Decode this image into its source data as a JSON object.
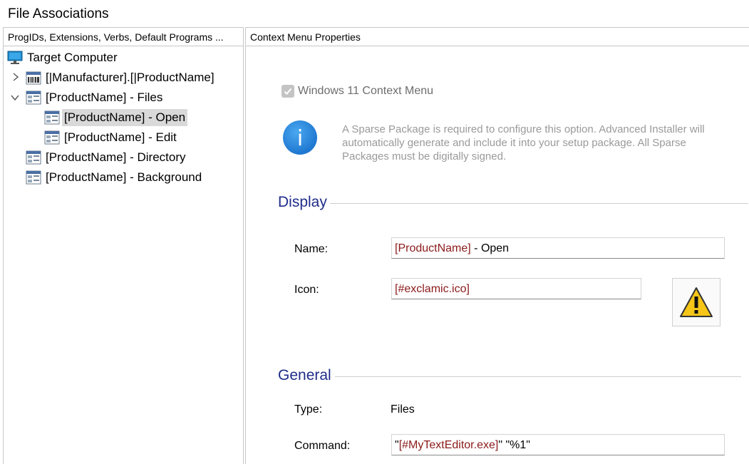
{
  "window": {
    "title": "File Associations"
  },
  "left_pane": {
    "header": "ProgIDs, Extensions, Verbs, Default Programs ...",
    "tree": [
      {
        "label": "Target Computer",
        "icon": "monitor-icon"
      },
      {
        "label": "[|Manufacturer].[|ProductName]",
        "icon": "building-icon",
        "expander": "collapsed"
      },
      {
        "label": "[ProductName] - Files",
        "icon": "progid-icon",
        "expander": "expanded"
      },
      {
        "label": "[ProductName] - Open",
        "icon": "verb-icon",
        "selected": true
      },
      {
        "label": "[ProductName] - Edit",
        "icon": "verb-icon"
      },
      {
        "label": "[ProductName] - Directory",
        "icon": "progid-icon"
      },
      {
        "label": "[ProductName] - Background",
        "icon": "progid-icon"
      }
    ]
  },
  "right_pane": {
    "header": "Context Menu Properties",
    "win11_checkbox": {
      "label": "Windows 11 Context Menu",
      "checked": true,
      "disabled": true
    },
    "info_text": "A Sparse Package is required to configure this option. Advanced Installer will automatically generate and include it into your setup package. All Sparse Packages must be digitally signed.",
    "display": {
      "heading": "Display",
      "name_label": "Name:",
      "name_value_bracket": "[ProductName]",
      "name_value_rest": " - Open",
      "icon_label": "Icon:",
      "icon_value": "[#exclamic.ico]",
      "icon_preview": "warning-icon"
    },
    "general": {
      "heading": "General",
      "type_label": "Type:",
      "type_value": "Files",
      "command_label": "Command:",
      "command_quote_open": "\"",
      "command_bracket": "[#MyTextEditor.exe]",
      "command_rest": "\" \"%1\""
    }
  },
  "colors": {
    "accent_heading": "#1f2d8a",
    "property_ref": "#8b1a1a",
    "info_blue": "#1f78d1",
    "warning_yellow": "#f5c518"
  }
}
